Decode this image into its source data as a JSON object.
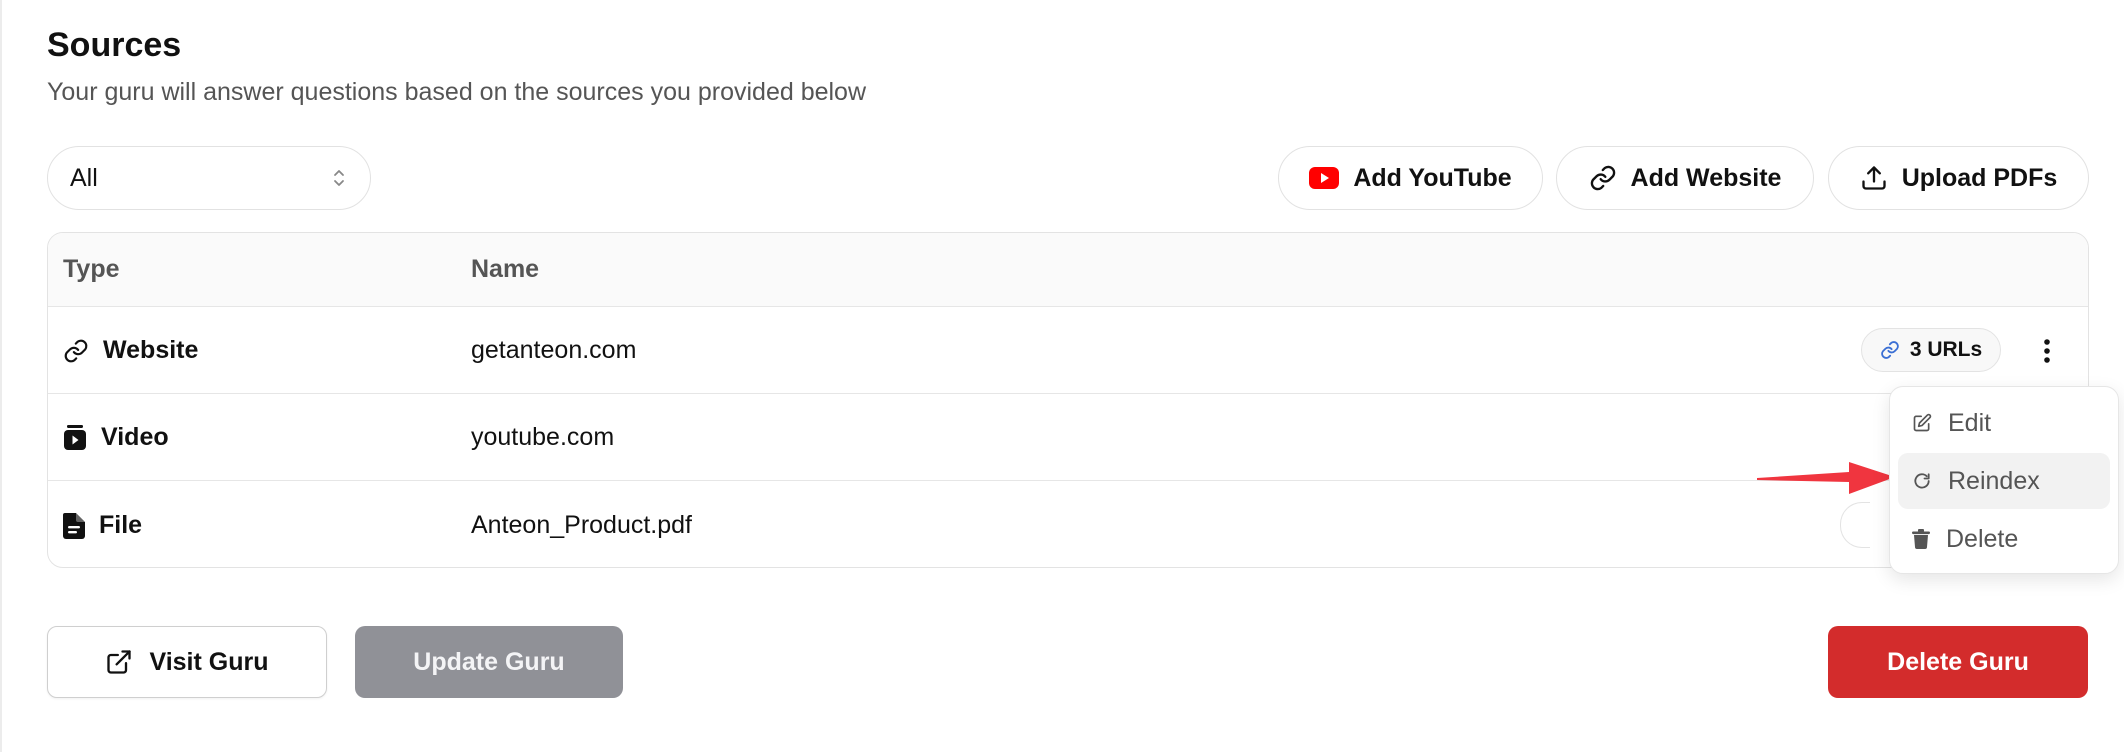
{
  "header": {
    "title": "Sources",
    "subtitle": "Your guru will answer questions based on the sources you provided below"
  },
  "filter": {
    "selected": "All"
  },
  "actions": {
    "add_youtube": "Add YouTube",
    "add_website": "Add Website",
    "upload_pdfs": "Upload PDFs"
  },
  "table": {
    "columns": [
      "Type",
      "Name"
    ],
    "rows": [
      {
        "type": "Website",
        "name": "getanteon.com",
        "badge": "3 URLs",
        "icon": "link-icon"
      },
      {
        "type": "Video",
        "name": "youtube.com",
        "icon": "video-icon"
      },
      {
        "type": "File",
        "name": "Anteon_Product.pdf",
        "icon": "file-icon"
      }
    ]
  },
  "context_menu": {
    "items": [
      {
        "label": "Edit",
        "icon": "edit-icon"
      },
      {
        "label": "Reindex",
        "icon": "refresh-icon"
      },
      {
        "label": "Delete",
        "icon": "trash-icon"
      }
    ]
  },
  "footer": {
    "visit_guru": "Visit Guru",
    "update_guru": "Update Guru",
    "delete_guru": "Delete Guru"
  },
  "colors": {
    "youtube_red": "#ff0000",
    "delete_red": "#d32c2c",
    "disabled_gray": "#909197",
    "annotation_arrow": "#f0353f",
    "link_blue": "#3b6fd4"
  }
}
